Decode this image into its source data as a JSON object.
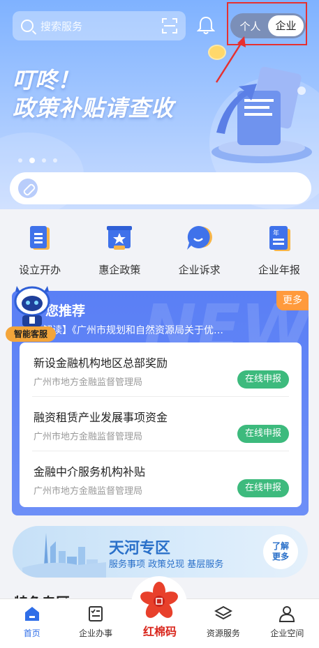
{
  "header": {
    "search_placeholder": "搜索服务",
    "toggle": {
      "personal": "个人",
      "enterprise": "企业",
      "selected": "enterprise"
    }
  },
  "banner": {
    "line1": "叮咚！",
    "line2": "政策补贴请查收",
    "slide_count": 4,
    "active_slide": 1
  },
  "services": [
    {
      "label": "设立开办",
      "icon": "document-icon"
    },
    {
      "label": "惠企政策",
      "icon": "policy-star-icon"
    },
    {
      "label": "企业诉求",
      "icon": "chat-bubble-icon"
    },
    {
      "label": "企业年报",
      "icon": "annual-report-icon"
    }
  ],
  "recommend": {
    "title": "您推荐",
    "more": "更多",
    "news": "解读】《广州市规划和自然资源局关于优…",
    "assistant_label": "智能客服",
    "items": [
      {
        "name": "新设金融机构地区总部奖励",
        "org": "广州市地方金融监督管理局",
        "action": "在线申报"
      },
      {
        "name": "融资租赁产业发展事项资金",
        "org": "广州市地方金融监督管理局",
        "action": "在线申报"
      },
      {
        "name": "金融中介服务机构补贴",
        "org": "广州市地方金融监督管理局",
        "action": "在线申报"
      }
    ]
  },
  "tianhe": {
    "title": "天河专区",
    "subtitle": "服务事项  政策兑现  基层服务",
    "learn_more_1": "了解",
    "learn_more_2": "更多"
  },
  "section_peek": "特色专区",
  "tabbar": {
    "home": "首页",
    "business": "企业办事",
    "center": "红棉码",
    "resources": "资源服务",
    "space": "企业空间"
  }
}
